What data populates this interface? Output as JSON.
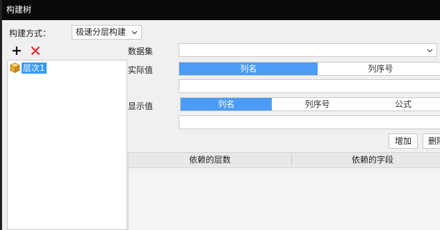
{
  "window": {
    "title": "构建树"
  },
  "build_mode": {
    "label": "构建方式：",
    "selected": "极速分层构建"
  },
  "tree": {
    "toolbar": {
      "add_icon": "plus-icon",
      "delete_icon": "red-x-icon"
    },
    "nodes": [
      {
        "label": "层次1",
        "icon": "cube-icon",
        "selected": true
      }
    ]
  },
  "dataset": {
    "label": "数据集",
    "value": ""
  },
  "actual_value": {
    "label": "实际值",
    "options": [
      "列名",
      "列序号"
    ],
    "selected": "列名",
    "input_value": ""
  },
  "display_value": {
    "label": "显示值",
    "options": [
      "列名",
      "列序号",
      "公式"
    ],
    "selected": "列名",
    "input_value": ""
  },
  "buttons": {
    "add": "增加",
    "delete": "删除"
  },
  "table": {
    "columns": [
      "依赖的层数",
      "依赖的字段"
    ],
    "rows": []
  },
  "colors": {
    "accent": "#4a9cf6",
    "selection": "#3399ff",
    "delete": "#e0262b"
  }
}
